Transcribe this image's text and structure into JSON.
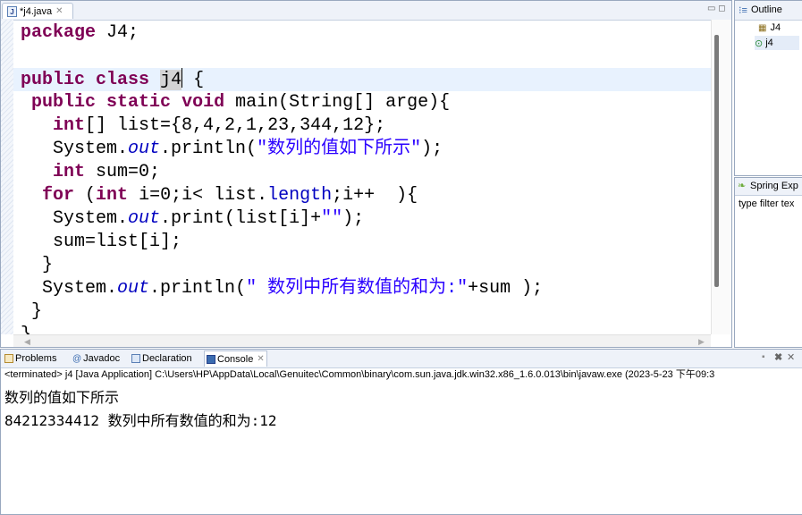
{
  "editor": {
    "tab_title": "*j4.java",
    "tab_close": "✕",
    "tab_icon_glyph": "J",
    "window_buttons": "▭ ◻",
    "lines": {
      "l1": {
        "a": "package",
        "b": " J4;"
      },
      "l2": {
        "a": "public",
        "b": " ",
        "c": "class",
        "d": " ",
        "e": "j4",
        "f": " {"
      },
      "l3": {
        "a": " ",
        "b": "public",
        "c": " ",
        "d": "static",
        "e": " ",
        "f": "void",
        "g": " main(String[] arge){"
      },
      "l4": {
        "a": "   ",
        "b": "int",
        "c": "[] list={8,4,2,1,23,344,12};"
      },
      "l5": {
        "a": "   System.",
        "b": "out",
        "c": ".println(",
        "d": "\"数列的值如下所示\"",
        "e": ");"
      },
      "l6": {
        "a": "   ",
        "b": "int",
        "c": " sum=0;"
      },
      "l7": {
        "a": "  ",
        "b": "for",
        "c": " (",
        "d": "int",
        "e": " i=0;i< list.",
        "f": "length",
        "g": ";i++  ){"
      },
      "l8": {
        "a": "   System.",
        "b": "out",
        "c": ".print(list[i]+",
        "d": "\"\"",
        "e": ");"
      },
      "l9": {
        "a": "   sum=list[i];"
      },
      "l10": {
        "a": "  }"
      },
      "l11": {
        "a": "  System.",
        "b": "out",
        "c": ".println(",
        "d": "\" 数列中所有数值的和为:\"",
        "e": "+sum );"
      },
      "l12": {
        "a": " }"
      },
      "l13": {
        "a": "}"
      }
    }
  },
  "outline": {
    "title": "Outline",
    "items": [
      "J4",
      "j4"
    ]
  },
  "spring": {
    "title": "Spring Exp",
    "filter_placeholder": "type filter tex"
  },
  "console": {
    "tabs": [
      "Problems",
      "Javadoc",
      "Declaration",
      "Console"
    ],
    "terminated": "<terminated> j4 [Java Application] C:\\Users\\HP\\AppData\\Local\\Genuitec\\Common\\binary\\com.sun.java.jdk.win32.x86_1.6.0.013\\bin\\javaw.exe (2023-5-23 下午09:3",
    "output": [
      "数列的值如下所示",
      "84212334412 数列中所有数值的和为:12"
    ]
  },
  "colors": {
    "keyword": "#7f0055",
    "string": "#2a00ff",
    "field": "#0000c0",
    "current_line": "#e8f2fe"
  }
}
